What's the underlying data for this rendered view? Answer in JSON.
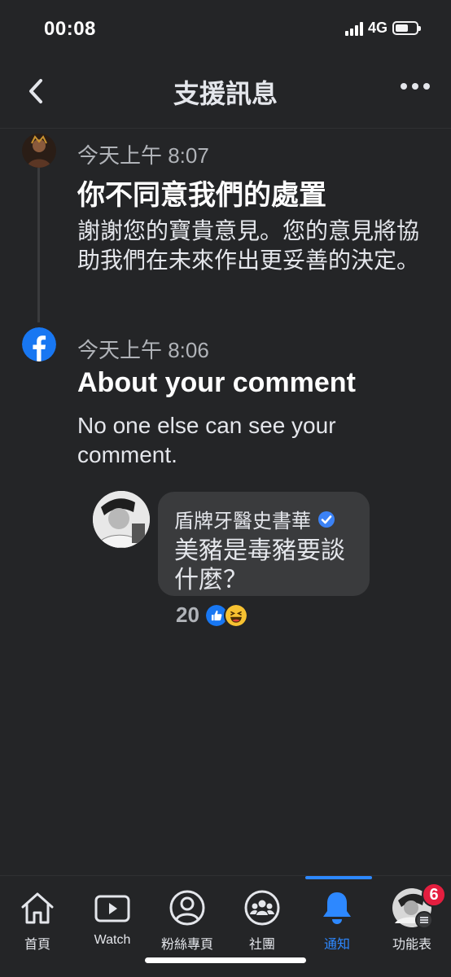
{
  "status": {
    "time": "00:08",
    "network": "4G"
  },
  "header": {
    "title": "支援訊息"
  },
  "messages": [
    {
      "time": "今天上午 8:07",
      "title": "你不同意我們的處置",
      "body": "謝謝您的寶貴意見。您的意見將協助我們在未來作出更妥善的決定。",
      "avatar": "user-avatar"
    },
    {
      "time": "今天上午 8:06",
      "title": "About your comment",
      "body": "No one else can see your comment.",
      "avatar": "facebook-logo-icon"
    }
  ],
  "comment": {
    "author": "盾牌牙醫史書華",
    "text": "美豬是毒豬要談什麼？",
    "reaction_count": "20",
    "reactions": [
      "like-reaction-icon",
      "haha-reaction-icon"
    ]
  },
  "tabs": [
    {
      "label": "首頁",
      "icon": "home-icon"
    },
    {
      "label": "Watch",
      "icon": "watch-icon"
    },
    {
      "label": "粉絲專頁",
      "icon": "pages-icon"
    },
    {
      "label": "社團",
      "icon": "groups-icon"
    },
    {
      "label": "通知",
      "icon": "bell-icon",
      "active": true
    },
    {
      "label": "功能表",
      "icon": "menu-icon",
      "badge": "6"
    }
  ],
  "colors": {
    "accent": "#2d88ff",
    "background": "#242527",
    "badge": "#e41e3f",
    "bubble": "#3a3b3d"
  }
}
